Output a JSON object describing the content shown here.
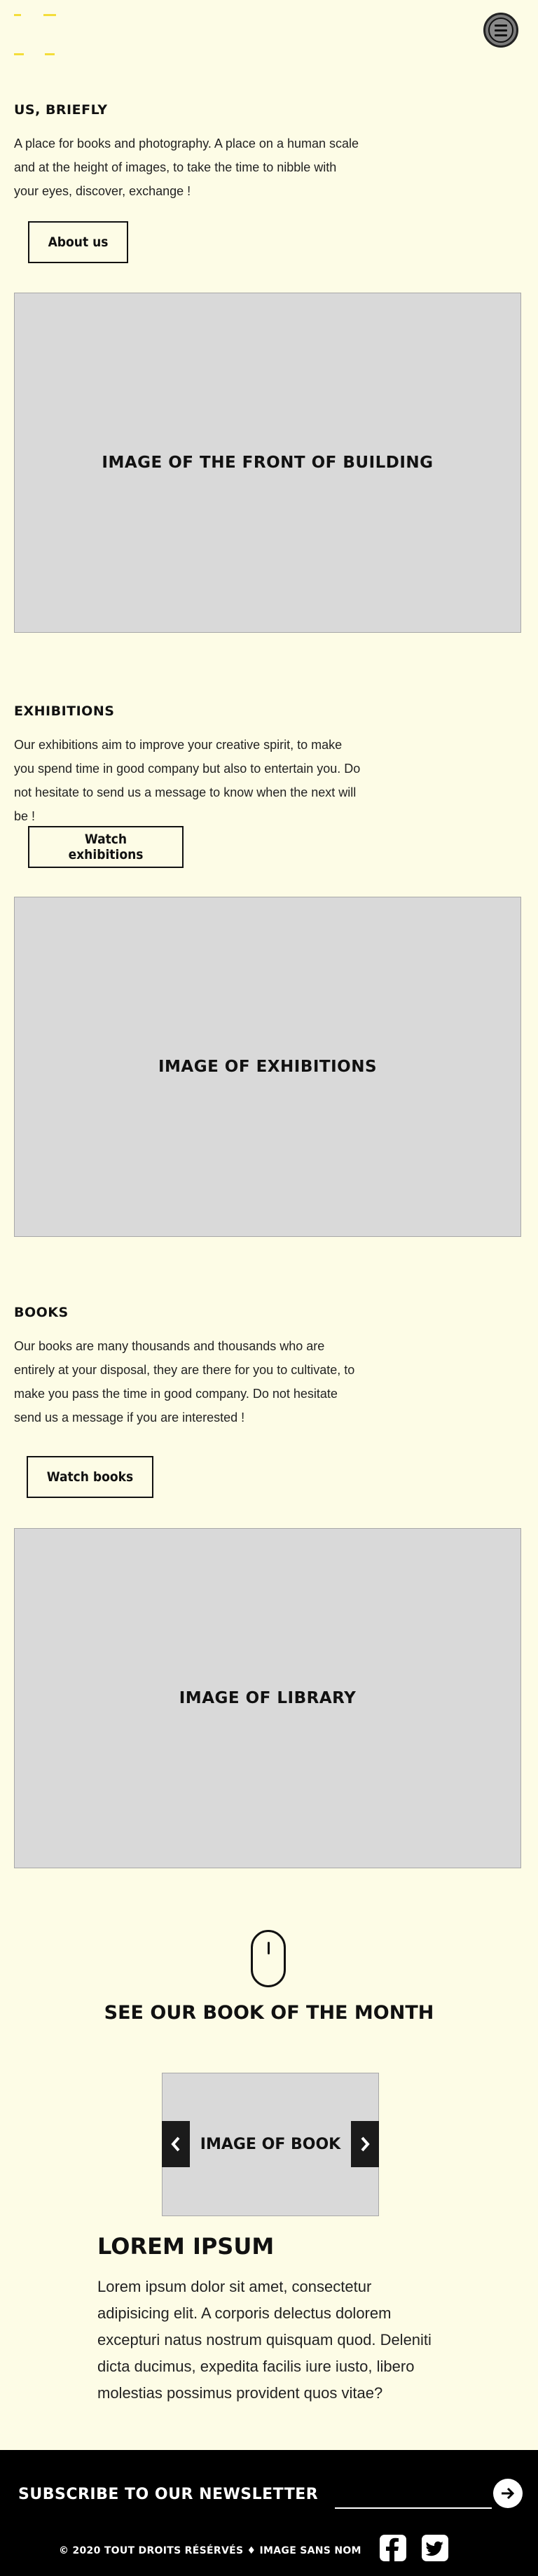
{
  "header": {
    "logo_icon": "logo-mark",
    "menu_icon": "hamburger-icon",
    "accent_color": "#f4dd3a"
  },
  "about": {
    "title": "US, BRIEFLY",
    "text": "A place for books and photography. A place on a human scale and at the height of images, to take the time to nibble with your eyes, discover, exchange !",
    "button_label": "About us",
    "image_label": "IMAGE OF THE FRONT OF BUILDING"
  },
  "exhibitions": {
    "title": "EXHIBITIONS",
    "text": "Our exhibitions aim to improve your creative spirit, to make you spend time in good company but also to entertain you. Do not hesitate to send us a message to know when the next will be !",
    "button_label": "Watch exhibitions",
    "image_label": "IMAGE OF EXHIBITIONS"
  },
  "books": {
    "title": "BOOKS",
    "text": "Our books are many thousands and thousands who are entirely at your disposal, they are there for you to cultivate, to make you pass the time in good company. Do not hesitate send us a message if you are interested !",
    "button_label": "Watch books",
    "image_label": "IMAGE OF LIBRARY"
  },
  "book_of_month": {
    "scroll_icon": "mouse-scroll-icon",
    "title": "SEE OUR BOOK OF THE MONTH",
    "carousel_label": "IMAGE OF BOOK",
    "prev_icon": "chevron-left-icon",
    "next_icon": "chevron-right-icon",
    "book_title": "LOREM IPSUM",
    "book_text": "Lorem ipsum dolor sit amet, consectetur adipisicing elit. A corporis delectus dolorem excepturi natus nostrum quisquam quod. Deleniti dicta ducimus, expedita facilis iure iusto, libero molestias possimus provident quos vitae?"
  },
  "footer": {
    "newsletter_label": "SUBSCRIBE TO OUR NEWSLETTER",
    "newsletter_value": "",
    "submit_icon": "arrow-right-icon",
    "copyright": "© 2020 TOUT DROITS RÉSÉRVÉS ♦ IMAGE SANS NOM",
    "social": [
      "facebook-icon",
      "twitter-icon"
    ]
  }
}
